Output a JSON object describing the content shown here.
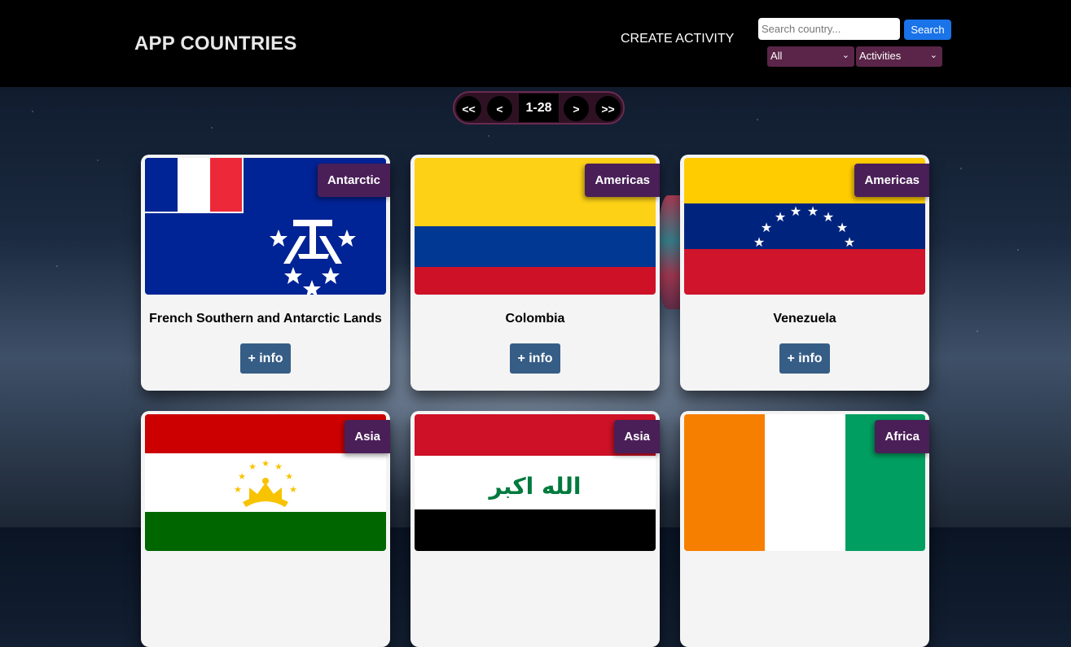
{
  "header": {
    "brand": "APP COUNTRIES",
    "create_link": "CREATE ACTIVITY",
    "search_placeholder": "Search country...",
    "search_button": "Search",
    "continent_select": "All",
    "activity_select": "Activities"
  },
  "pagination": {
    "first": "<<",
    "prev": "<",
    "range": "1-28",
    "next": ">",
    "last": ">>"
  },
  "info_label": "+ info",
  "cards": [
    {
      "name": "French Southern and Antarctic Lands",
      "continent": "Antarctic",
      "flag_icon": "french-southern-lands-flag"
    },
    {
      "name": "Colombia",
      "continent": "Americas",
      "flag_icon": "colombia-flag"
    },
    {
      "name": "Venezuela",
      "continent": "Americas",
      "flag_icon": "venezuela-flag"
    },
    {
      "name": "",
      "continent": "Asia",
      "flag_icon": "tajikistan-flag"
    },
    {
      "name": "",
      "continent": "Asia",
      "flag_icon": "iraq-flag"
    },
    {
      "name": "",
      "continent": "Africa",
      "flag_icon": "ivory-coast-flag"
    }
  ],
  "flag_text": {
    "iraq": "الله اكبر"
  },
  "colors": {
    "header_bg": "#000000",
    "select_bg": "#5a2548",
    "badge_bg": "#4a1f58",
    "info_button_bg": "#365d86",
    "search_button_bg": "#1a73e8"
  }
}
